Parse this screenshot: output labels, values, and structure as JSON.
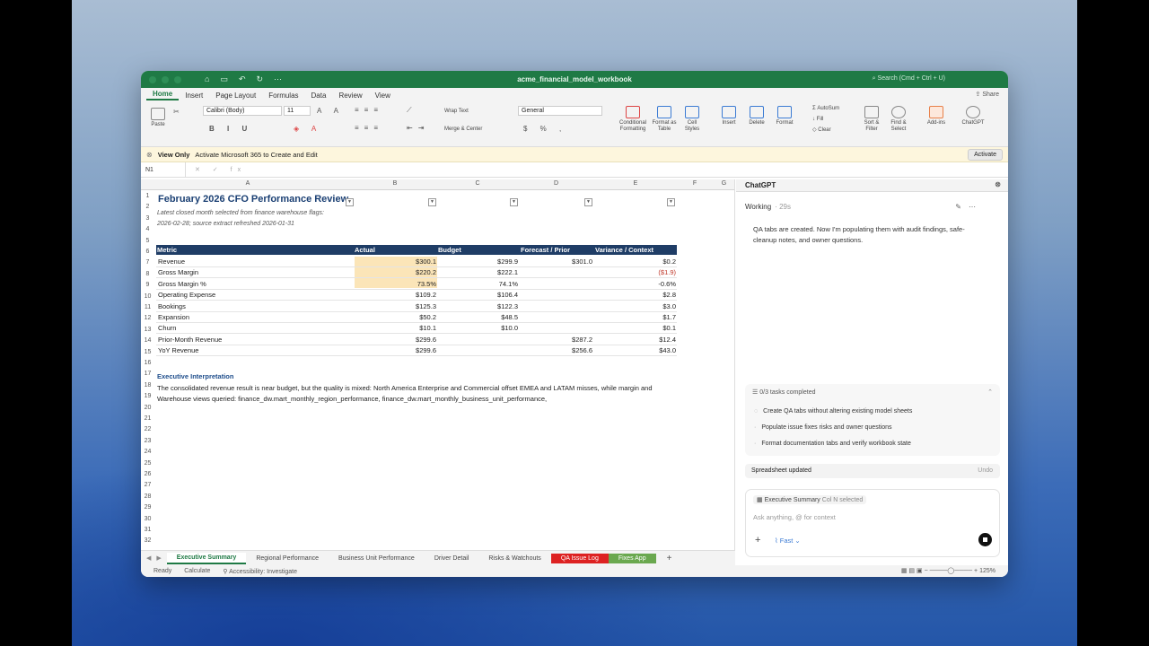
{
  "window": {
    "title": "acme_financial_model_workbook",
    "search_placeholder": "Search (Cmd + Ctrl + U)",
    "share_label": "Share"
  },
  "ribbon_tabs": [
    "Home",
    "Insert",
    "Page Layout",
    "Formulas",
    "Data",
    "Review",
    "View"
  ],
  "ribbon": {
    "paste": "Paste",
    "font_name": "Calibri (Body)",
    "font_size": "11",
    "wrap_text": "Wrap Text",
    "merge_center": "Merge & Center",
    "number_format": "General",
    "conditional_formatting": "Conditional Formatting",
    "format_as_table": "Format as Table",
    "cell_styles": "Cell Styles",
    "insert": "Insert",
    "delete": "Delete",
    "format": "Format",
    "autosum": "AutoSum",
    "fill": "Fill",
    "clear": "Clear",
    "sort_filter": "Sort & Filter",
    "find_select": "Find & Select",
    "add_ins": "Add-ins",
    "chatgpt": "ChatGPT"
  },
  "infobar": {
    "label": "View Only",
    "message": "Activate Microsoft 365 to Create and Edit",
    "button": "Activate"
  },
  "formula_bar": {
    "name_box": "N1"
  },
  "columns": [
    "A",
    "B",
    "C",
    "D",
    "E",
    "F",
    "G"
  ],
  "rows": [
    "1",
    "2",
    "3",
    "4",
    "5",
    "6",
    "7",
    "8",
    "9",
    "10",
    "11",
    "12",
    "13",
    "14",
    "15",
    "16",
    "17",
    "18",
    "19",
    "20",
    "21",
    "22",
    "23",
    "24",
    "25",
    "26",
    "27",
    "28",
    "29",
    "30",
    "31",
    "32"
  ],
  "sheet": {
    "title": "February 2026 CFO Performance Review",
    "subtitle1": "Latest closed month selected from finance warehouse flags:",
    "subtitle2": "2026-02-28; source extract refreshed 2026-01-31",
    "headers": [
      "Metric",
      "Actual",
      "Budget",
      "Forecast / Prior",
      "Variance / Context"
    ],
    "table": [
      {
        "metric": "Revenue",
        "actual": "$300.1",
        "budget": "$299.9",
        "forecast": "$301.0",
        "variance": "$0.2"
      },
      {
        "metric": "Gross Margin",
        "actual": "$220.2",
        "budget": "$222.1",
        "forecast": "",
        "variance": "($1.9)"
      },
      {
        "metric": "Gross Margin %",
        "actual": "73.5%",
        "budget": "74.1%",
        "forecast": "",
        "variance": "-0.6%"
      },
      {
        "metric": "Operating Expense",
        "actual": "$109.2",
        "budget": "$106.4",
        "forecast": "",
        "variance": "$2.8"
      },
      {
        "metric": "Bookings",
        "actual": "$125.3",
        "budget": "$122.3",
        "forecast": "",
        "variance": "$3.0"
      },
      {
        "metric": "Expansion",
        "actual": "$50.2",
        "budget": "$48.5",
        "forecast": "",
        "variance": "$1.7"
      },
      {
        "metric": "Churn",
        "actual": "$10.1",
        "budget": "$10.0",
        "forecast": "",
        "variance": "$0.1"
      },
      {
        "metric": "Prior-Month Revenue",
        "actual": "$299.6",
        "budget": "",
        "forecast": "$287.2",
        "variance": "$12.4"
      },
      {
        "metric": "YoY Revenue",
        "actual": "$299.6",
        "budget": "",
        "forecast": "$256.6",
        "variance": "$43.0"
      }
    ],
    "section_title": "Executive Interpretation",
    "interp_line1": "The consolidated revenue result is near budget, but the quality is mixed: North America Enterprise and Commercial offset EMEA and LATAM misses, while margin and",
    "interp_line2": "Warehouse views queried: finance_dw.mart_monthly_region_performance, finance_dw.mart_monthly_business_unit_performance,"
  },
  "sheet_tabs": [
    "Executive Summary",
    "Regional Performance",
    "Business Unit Performance",
    "Driver Detail",
    "Risks & Watchouts",
    "QA Issue Log",
    "Fixes App"
  ],
  "status": {
    "ready": "Ready",
    "calculate": "Calculate",
    "accessibility": "Accessibility: Investigate",
    "zoom": "125%"
  },
  "chat": {
    "title": "ChatGPT",
    "status": "Working",
    "elapsed": "29s",
    "message": "QA tabs are created. Now I'm populating them with audit findings, safe-cleanup notes, and owner questions.",
    "tasks_header": "0/3 tasks completed",
    "tasks": [
      "Create QA tabs without altering existing model sheets",
      "Populate issue fixes risks and owner questions",
      "Format documentation tabs and verify workbook state"
    ],
    "updated": "Spreadsheet updated",
    "undo": "Undo",
    "context_sheet": "Executive Summary",
    "context_sel": "Col N selected",
    "placeholder": "Ask anything, @ for context",
    "mode": "Fast"
  }
}
